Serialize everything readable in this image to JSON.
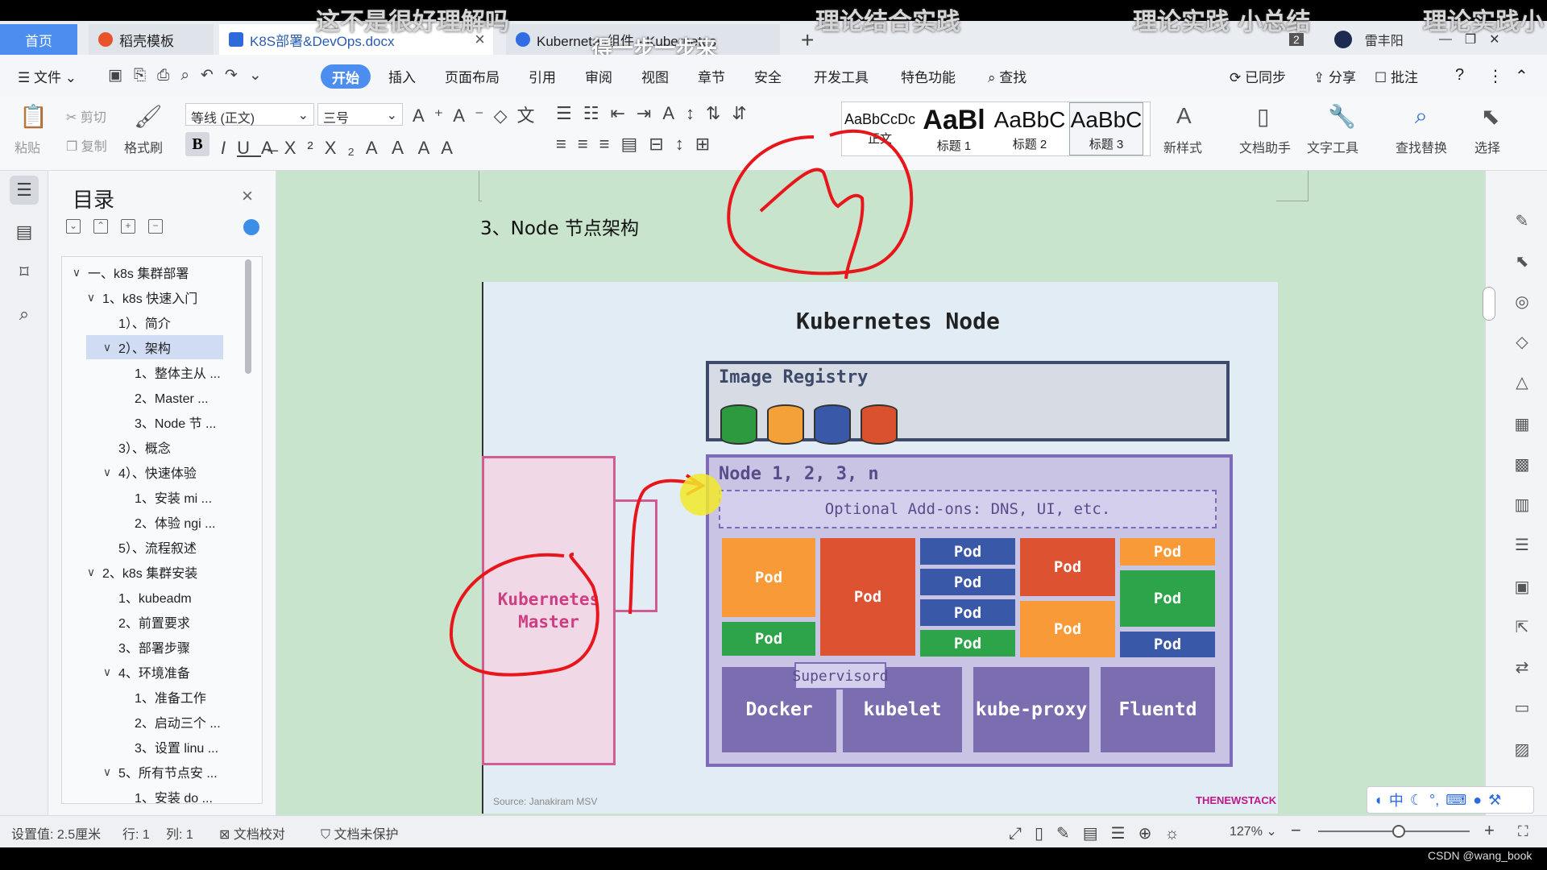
{
  "captions": [
    "这不是很好理解吗",
    "理论结合实践",
    "理论实践  小总结",
    "理论实践小",
    "得一步一步来"
  ],
  "tabs": {
    "home": "首页",
    "template": "稻壳模板",
    "doc": "K8S部署&DevOps.docx",
    "k8s": "Kubernetes组件 - Kubernetes",
    "badge": "2",
    "user": "雷丰阳"
  },
  "menu": {
    "file": "文件",
    "start": "开始",
    "items": [
      "插入",
      "页面布局",
      "引用",
      "审阅",
      "视图",
      "章节",
      "安全",
      "开发工具",
      "特色功能"
    ],
    "search": "查找",
    "sync": "已同步",
    "share": "分享",
    "comment": "批注"
  },
  "ribbon": {
    "paste": "粘贴",
    "cut": "剪切",
    "copy": "复制",
    "format_painter": "格式刷",
    "font": "等线 (正文)",
    "size": "三号",
    "styles": [
      {
        "sample": "AaBbCcDc",
        "label": "正文"
      },
      {
        "sample": "AaBl",
        "label": "标题 1"
      },
      {
        "sample": "AaBbC",
        "label": "标题 2"
      },
      {
        "sample": "AaBbC",
        "label": "标题 3"
      }
    ],
    "new_style": "新样式",
    "doc_assistant": "文档助手",
    "text_tools": "文字工具",
    "find_replace": "查找替换",
    "select": "选择"
  },
  "nav": {
    "title": "目录",
    "items": [
      {
        "text": "一、k8s 集群部署",
        "caret": "∨",
        "level": 0
      },
      {
        "text": "1、k8s 快速入门",
        "caret": "∨",
        "level": 1
      },
      {
        "text": "1）、简介",
        "caret": "",
        "level": 2
      },
      {
        "text": "2）、架构",
        "caret": "∨",
        "level": 2,
        "selected": true
      },
      {
        "text": "1、整体主从 ...",
        "caret": "",
        "level": 3
      },
      {
        "text": "2、Master ...",
        "caret": "",
        "level": 3
      },
      {
        "text": "3、Node 节 ...",
        "caret": "",
        "level": 3
      },
      {
        "text": "3）、概念",
        "caret": "",
        "level": 2
      },
      {
        "text": "4）、快速体验",
        "caret": "∨",
        "level": 2
      },
      {
        "text": "1、安装 mi ...",
        "caret": "",
        "level": 3
      },
      {
        "text": "2、体验 ngi ...",
        "caret": "",
        "level": 3
      },
      {
        "text": "5）、流程叙述",
        "caret": "",
        "level": 2
      },
      {
        "text": "2、k8s 集群安装",
        "caret": "∨",
        "level": 1
      },
      {
        "text": "1、kubeadm",
        "caret": "",
        "level": 2
      },
      {
        "text": "2、前置要求",
        "caret": "",
        "level": 2
      },
      {
        "text": "3、部署步骤",
        "caret": "",
        "level": 2
      },
      {
        "text": "4、环境准备",
        "caret": "∨",
        "level": 2
      },
      {
        "text": "1、准备工作",
        "caret": "",
        "level": 3
      },
      {
        "text": "2、启动三个 ...",
        "caret": "",
        "level": 3
      },
      {
        "text": "3、设置 linu ...",
        "caret": "",
        "level": 3
      },
      {
        "text": "5、所有节点安 ...",
        "caret": "∨",
        "level": 2
      },
      {
        "text": "1、安装 do ...",
        "caret": "",
        "level": 3
      }
    ]
  },
  "doc": {
    "heading": "3、Node 节点架构"
  },
  "diagram": {
    "title": "Kubernetes Node",
    "registry": "Image Registry",
    "registry_colors": [
      "#2e9a3f",
      "#f4a13a",
      "#3a58a8",
      "#d9522d"
    ],
    "node": "Node 1, 2, 3, n",
    "addons": "Optional Add-ons: DNS, UI, etc.",
    "pod": "Pod",
    "supervisord": "Supervisord",
    "blocks": [
      "Docker",
      "kubelet",
      "kube-proxy",
      "Fluentd"
    ],
    "master_line1": "Kubernetes",
    "master_line2": "Master",
    "source": "Source: Janakiram MSV",
    "brand": "THENEWSTACK"
  },
  "status": {
    "setting": "设置值: 2.5厘米",
    "row": "行: 1",
    "col": "列: 1",
    "proof": "文档校对",
    "protect": "文档未保护",
    "zoom": "127%"
  },
  "watermark": "CSDN @wang_book"
}
